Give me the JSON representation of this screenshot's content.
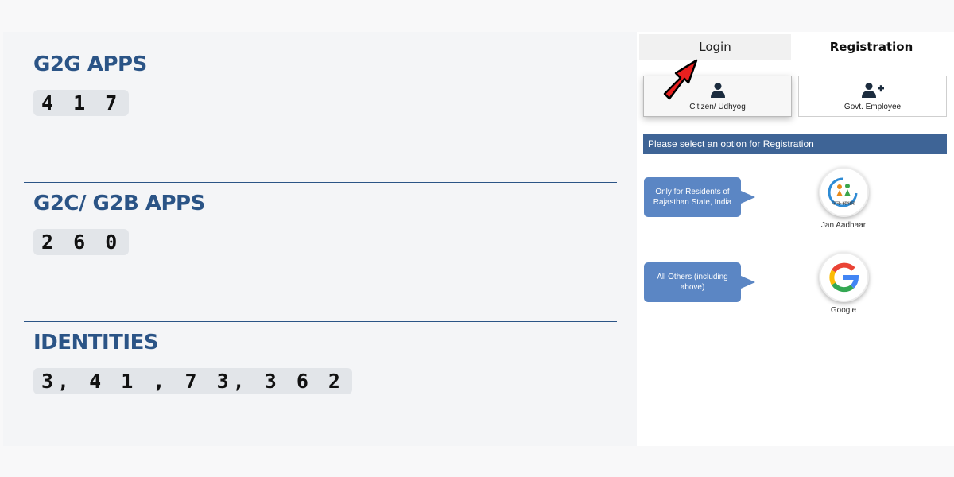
{
  "stats": [
    {
      "title": "G2G APPS",
      "value": "4 1 7"
    },
    {
      "title": "G2C/ G2B APPS",
      "value": "2 6 0"
    },
    {
      "title": "IDENTITIES",
      "value": "3, 4 1 , 7 3, 3 6 2"
    }
  ],
  "tabs": {
    "login": "Login",
    "registration": "Registration"
  },
  "user_types": {
    "citizen": "Citizen/ Udhyog",
    "govt": "Govt. Employee"
  },
  "select_prompt": "Please select an option for Registration",
  "options": [
    {
      "note": "Only for Residents of Rajasthan State, India",
      "provider": "Jan Aadhaar",
      "logo_text": "जन-आधार",
      "icon": "jan-aadhaar-logo"
    },
    {
      "note": "All Others (including above)",
      "provider": "Google",
      "icon": "google-logo"
    }
  ],
  "colors": {
    "title_blue": "#2b5486",
    "bar_blue": "#3e6496",
    "bubble_blue": "#5b86c4",
    "arrow_red": "#e8201f"
  }
}
